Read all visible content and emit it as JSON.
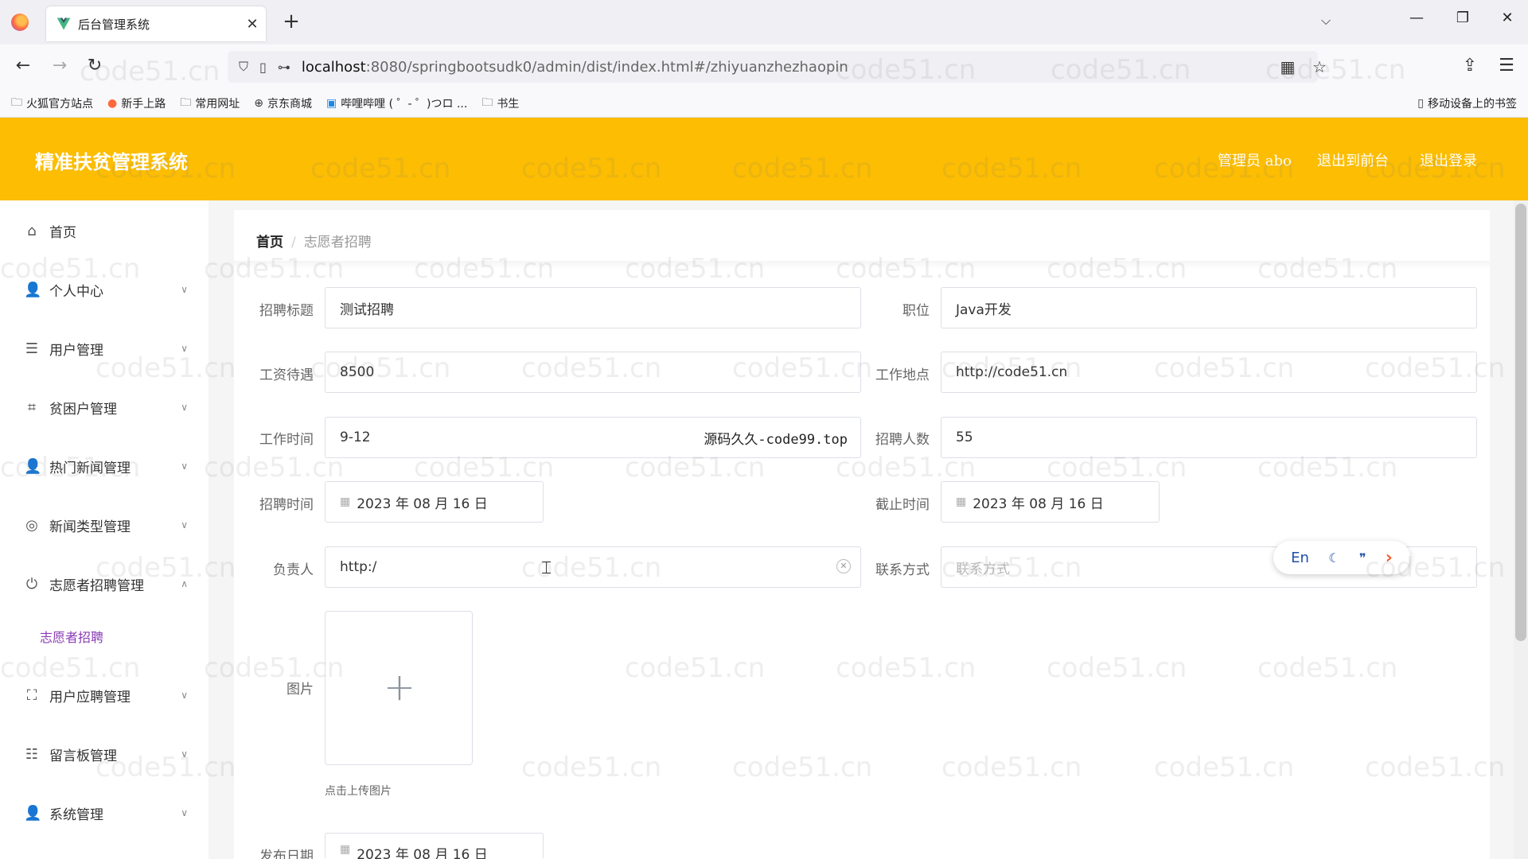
{
  "browser": {
    "tab_title": "后台管理系统",
    "url_host": "localhost",
    "url_rest": ":8080/springbootsudk0/admin/dist/index.html#/zhiyuanzhezhaopin",
    "bookmarks": [
      "火狐官方站点",
      "新手上路",
      "常用网址",
      "京东商城",
      "哔哩哔哩 ( ゜- ゜)つロ ...",
      "书生"
    ],
    "mobile_bookmarks": "移动设备上的书签"
  },
  "header": {
    "title": "精准扶贫管理系统",
    "admin": "管理员 abo",
    "to_front": "退出到前台",
    "logout": "退出登录"
  },
  "sidebar": {
    "items": [
      {
        "label": "首页",
        "icon": "home-icon"
      },
      {
        "label": "个人中心",
        "icon": "user-icon"
      },
      {
        "label": "用户管理",
        "icon": "list-icon"
      },
      {
        "label": "贫困户管理",
        "icon": "crop-icon"
      },
      {
        "label": "热门新闻管理",
        "icon": "person-icon"
      },
      {
        "label": "新闻类型管理",
        "icon": "globe-icon"
      },
      {
        "label": "志愿者招聘管理",
        "icon": "power-icon"
      },
      {
        "label": "用户应聘管理",
        "icon": "frame-icon"
      },
      {
        "label": "留言板管理",
        "icon": "sliders-icon"
      },
      {
        "label": "系统管理",
        "icon": "person-icon"
      }
    ],
    "active_sub": "志愿者招聘"
  },
  "breadcrumb": {
    "home": "首页",
    "current": "志愿者招聘"
  },
  "form": {
    "title_label": "招聘标题",
    "title_value": "测试招聘",
    "position_label": "职位",
    "position_value": "Java开发",
    "salary_label": "工资待遇",
    "salary_value": "8500",
    "location_label": "工作地点",
    "location_value": "http://code51.cn",
    "worktime_label": "工作时间",
    "worktime_value": "9-12",
    "worktime_overlay": "源码久久-code99.top",
    "count_label": "招聘人数",
    "count_value": "55",
    "start_label": "招聘时间",
    "start_value": "2023 年 08 月 16 日",
    "end_label": "截止时间",
    "end_value": "2023 年 08 月 16 日",
    "person_label": "负责人",
    "person_value": "http:/",
    "contact_label": "联系方式",
    "contact_placeholder": "联系方式",
    "image_label": "图片",
    "upload_tip": "点击上传图片",
    "publish_label": "发布日期",
    "publish_value": "2023 年 08 月 16 日"
  },
  "translate_bubble": {
    "en": "En"
  },
  "watermark": "code51.cn",
  "colors": {
    "header_bg": "#fcbd02",
    "active_sub": "#8a3cb5"
  }
}
